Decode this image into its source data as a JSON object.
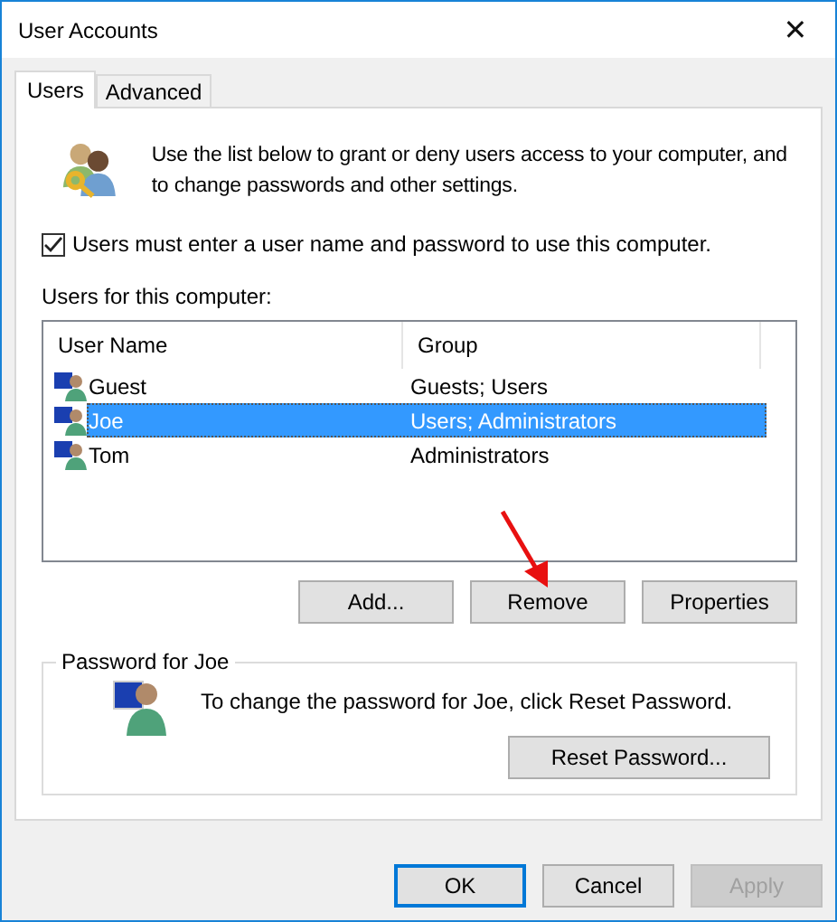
{
  "window": {
    "title": "User Accounts",
    "close": "✕"
  },
  "tabs": [
    {
      "label": "Users",
      "selected": true
    },
    {
      "label": "Advanced",
      "selected": false
    }
  ],
  "intro": "Use the list below to grant or deny users access to your computer, and to change passwords and other settings.",
  "require_login": {
    "label": "Users must enter a user name and password to use this computer.",
    "checked": true
  },
  "users_label": "Users for this computer:",
  "table": {
    "columns": [
      "User Name",
      "Group"
    ],
    "rows": [
      {
        "name": "Guest",
        "group": "Guests; Users",
        "selected": false
      },
      {
        "name": "Joe",
        "group": "Users; Administrators",
        "selected": true
      },
      {
        "name": "Tom",
        "group": "Administrators",
        "selected": false
      }
    ]
  },
  "list_buttons": [
    {
      "label": "Add...",
      "disabled": false
    },
    {
      "label": "Remove",
      "disabled": false
    },
    {
      "label": "Properties",
      "disabled": false
    }
  ],
  "password_group": {
    "title": "Password for Joe",
    "text": "To change the password for Joe, click Reset Password.",
    "button": "Reset Password..."
  },
  "dialog_buttons": [
    {
      "label": "OK",
      "default": true,
      "disabled": false
    },
    {
      "label": "Cancel",
      "default": false,
      "disabled": false
    },
    {
      "label": "Apply",
      "default": false,
      "disabled": true
    }
  ]
}
